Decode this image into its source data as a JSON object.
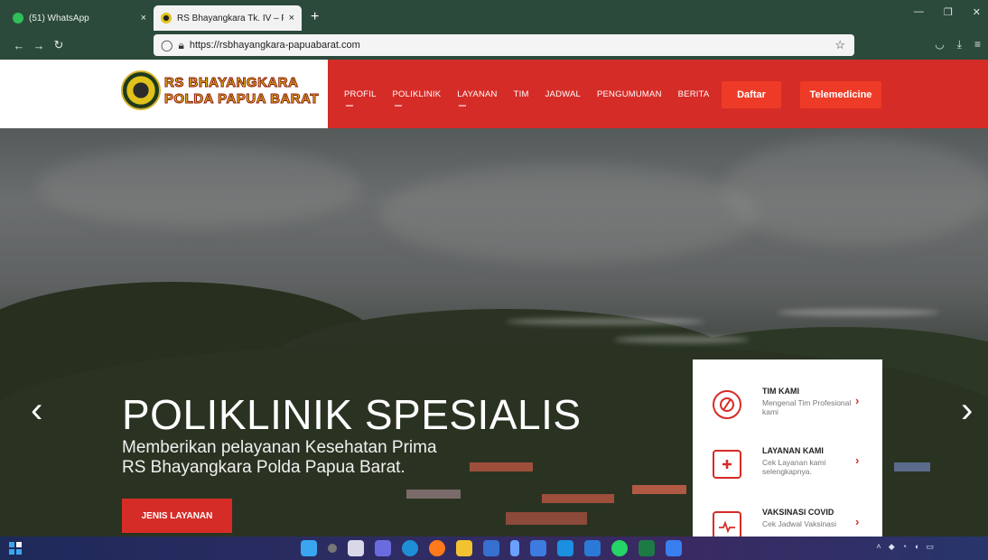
{
  "browser": {
    "tabs": [
      {
        "title": "(51) WhatsApp",
        "icon": "whatsapp-icon",
        "close": "×"
      },
      {
        "title": "RS Bhayangkara Tk. IV – Polda P",
        "icon": "site-favicon",
        "close": "×"
      }
    ],
    "new_tab": "+",
    "url": "https://rsbhayangkara-papuabarat.com"
  },
  "site": {
    "logo_line1": "RS BHAYANGKARA",
    "logo_line2": "POLDA PAPUA BARAT",
    "menu": [
      "PROFIL",
      "POLIKLINIK",
      "LAYANAN",
      "TIM",
      "JADWAL",
      "PENGUMUMAN",
      "BERITA"
    ],
    "btn_daftar": "Daftar",
    "btn_telemedicine": "Telemedicine"
  },
  "hero": {
    "title": "POLIKLINIK SPESIALIS",
    "subtitle_line1": "Memberikan pelayanan Kesehatan Prima",
    "subtitle_line2": "RS Bhayangkara Polda Papua Barat.",
    "button": "JENIS LAYANAN",
    "prev": "‹",
    "next": "›"
  },
  "info_card": [
    {
      "title": "TIM KAMI",
      "desc": "Mengenal Tim Profesional kami",
      "icon": "team-icon"
    },
    {
      "title": "LAYANAN KAMI",
      "desc": "Cek Layanan kami selengkapnya.",
      "icon": "medical-kit-icon"
    },
    {
      "title": "VAKSINASI COVID",
      "desc": "Cek Jadwal Vaksinasi",
      "icon": "vaccine-calendar-icon"
    }
  ],
  "colors": {
    "brand_red": "#d62c27",
    "button_red": "#ee3b27",
    "chrome_green": "#2c4a3c",
    "logo_yellow": "#e7c418"
  }
}
